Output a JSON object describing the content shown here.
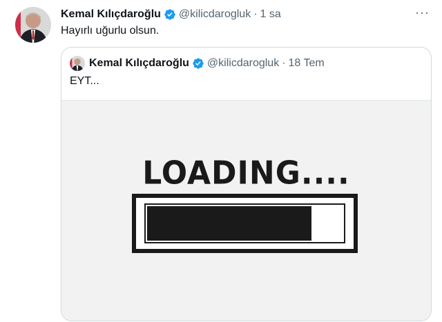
{
  "tweet": {
    "author_name": "Kemal Kılıçdaroğlu",
    "handle": "@kilicdarogluk",
    "separator": "·",
    "time": "1 sa",
    "text": "Hayırlı uğurlu olsun.",
    "more_label": "···"
  },
  "quoted_tweet": {
    "author_name": "Kemal Kılıçdaroğlu",
    "handle": "@kilicdarogluk",
    "separator": "·",
    "time": "18 Tem",
    "text": "EYT...",
    "image": {
      "title": "LOADING....",
      "progress": 0.84
    }
  },
  "colors": {
    "verified": "#1d9bf0",
    "secondary_text": "#536471",
    "border": "#cfd9de"
  },
  "icons": [
    "avatar",
    "verified-badge-icon",
    "more-options-icon"
  ]
}
